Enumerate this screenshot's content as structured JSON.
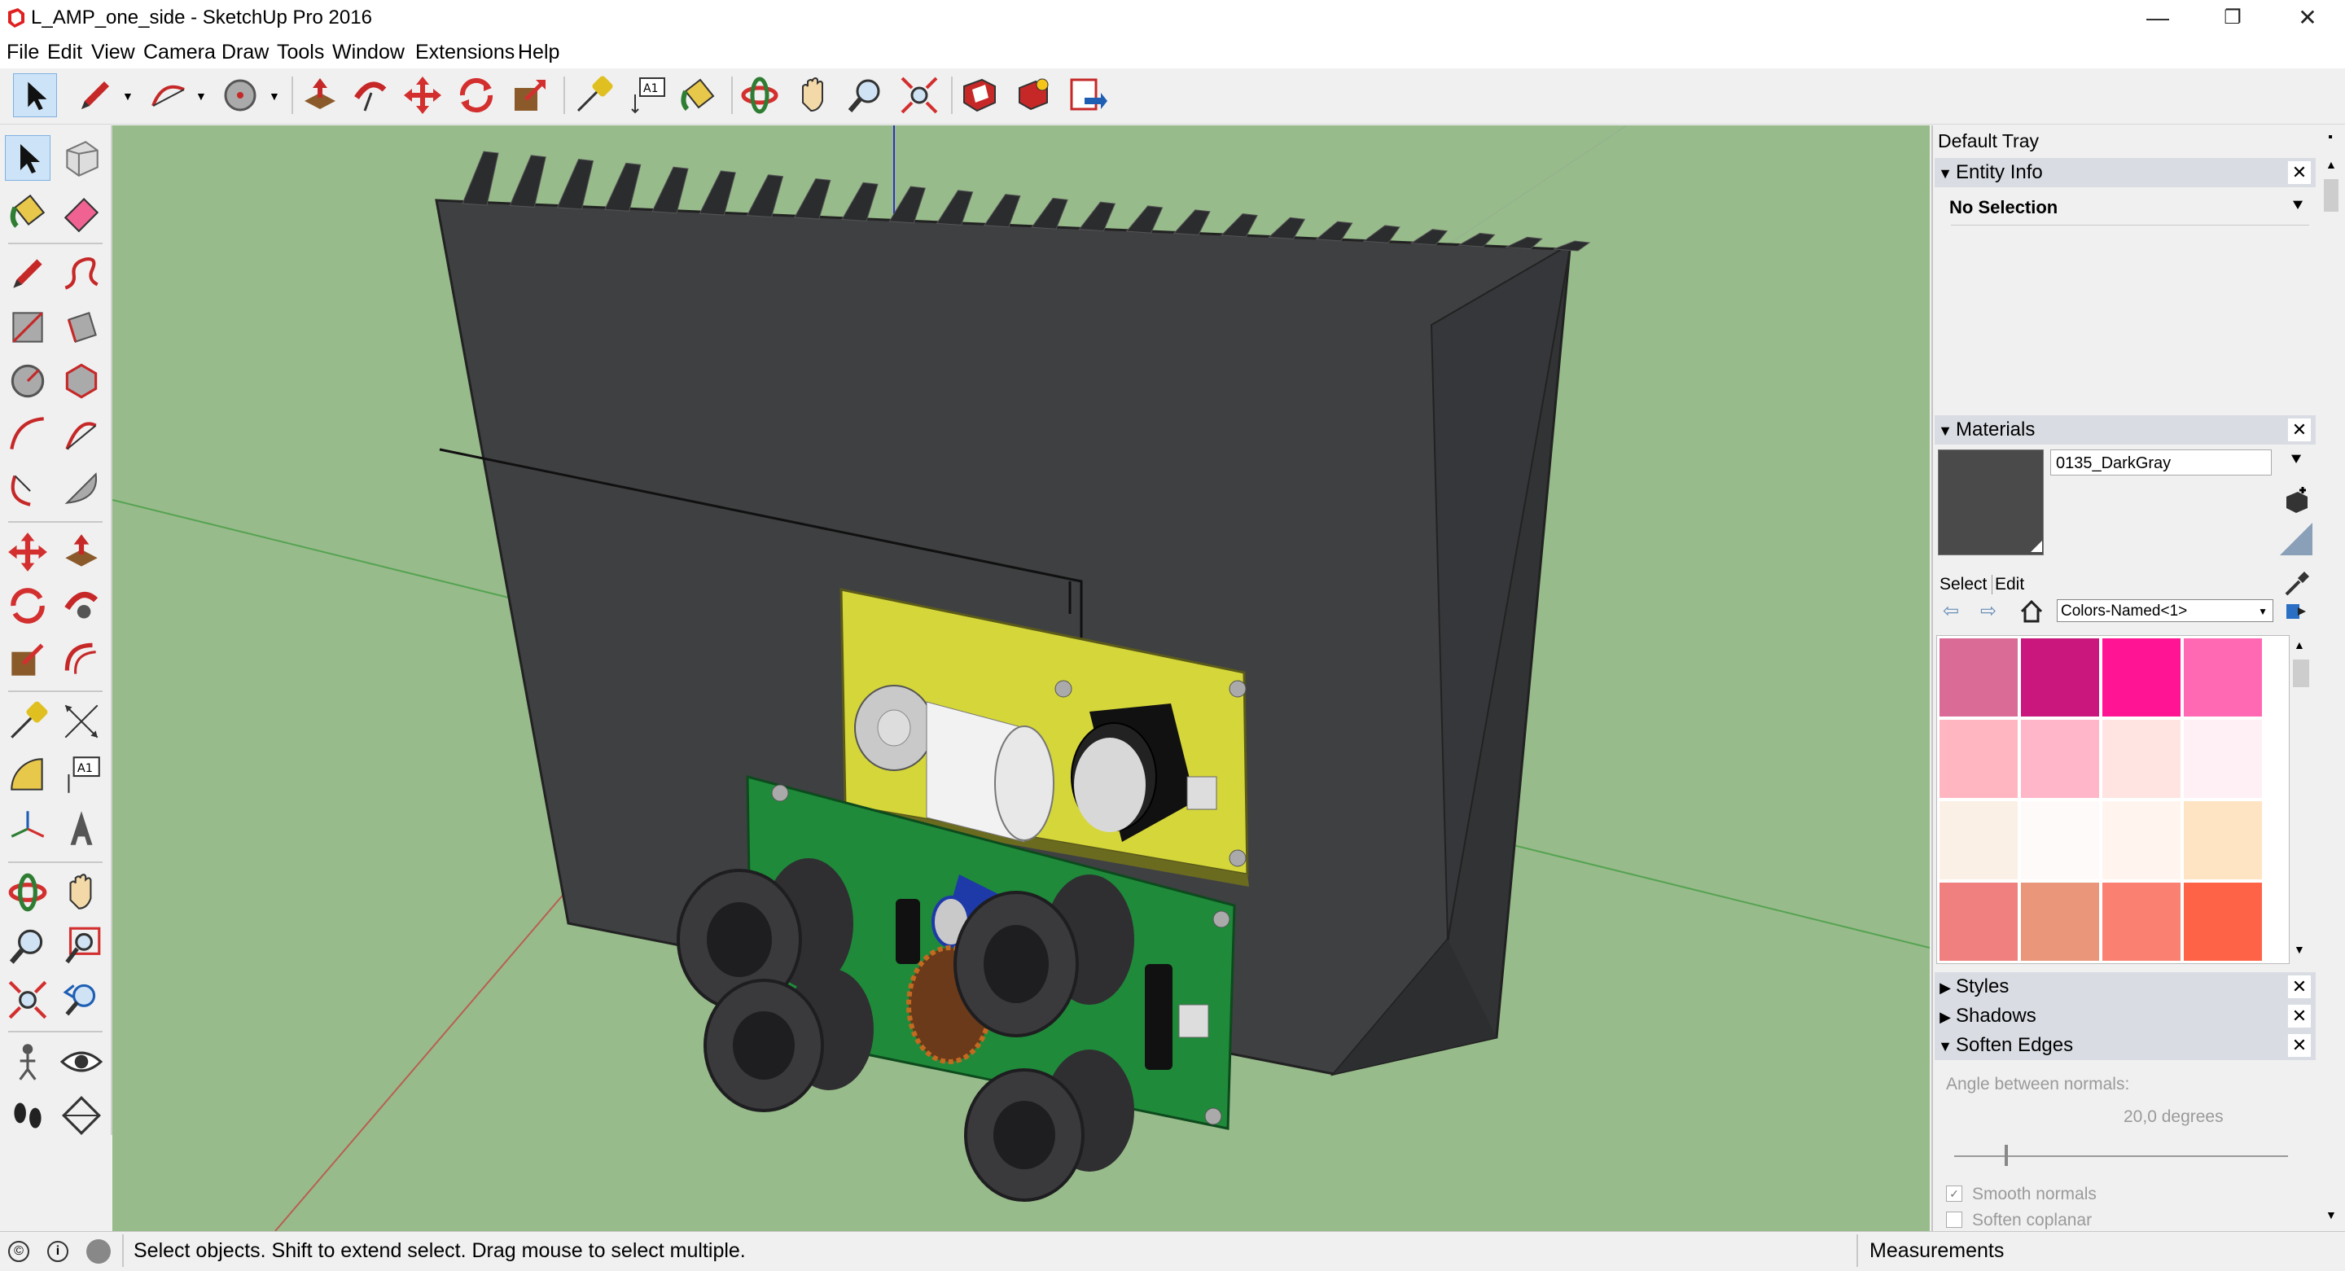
{
  "window": {
    "title": "L_AMP_one_side - SketchUp Pro 2016",
    "controls": {
      "minimize": "—",
      "restore": "❐",
      "close": "✕"
    }
  },
  "menu": [
    "File",
    "Edit",
    "View",
    "Camera",
    "Draw",
    "Tools",
    "Window",
    "Extensions",
    "Help"
  ],
  "toolbar_icons": [
    "select-icon",
    "pencil-icon",
    "arc-icon",
    "circle-icon",
    "push-pull-icon",
    "follow-me-icon",
    "move-icon",
    "rotate-icon",
    "scale-icon",
    "tape-measure-icon",
    "text-icon",
    "paint-bucket-icon",
    "orbit-icon",
    "pan-icon",
    "zoom-icon",
    "zoom-extents-icon",
    "3d-warehouse-icon",
    "extension-warehouse-icon",
    "layout-send-icon"
  ],
  "tray": {
    "title": "Default Tray",
    "entity_info": {
      "label": "Entity Info",
      "selection": "No Selection"
    },
    "materials": {
      "label": "Materials",
      "name_value": "0135_DarkGray",
      "preview_color": "#4a4a4a",
      "tab_select": "Select",
      "tab_edit": "Edit",
      "library": "Colors-Named<1>",
      "swatches": [
        "#d96b96",
        "#c9177e",
        "#ff1493",
        "#ff69b4",
        "#ffb6c1",
        "#ffb6c8",
        "#ffe4e1",
        "#fff0f5",
        "#faf0e6",
        "#fffafa",
        "#fff5ee",
        "#ffe4c4",
        "#f08080",
        "#e9967a",
        "#fa8072",
        "#ff6347"
      ]
    },
    "styles": {
      "label": "Styles"
    },
    "shadows": {
      "label": "Shadows"
    },
    "soften_edges": {
      "label": "Soften Edges",
      "angle_label": "Angle between normals:",
      "angle_value": "20,0  degrees",
      "angle_fraction": 0.15,
      "smooth_normals": "Smooth normals",
      "soften_coplanar": "Soften coplanar"
    }
  },
  "status": {
    "message": "Select objects. Shift to extend select. Drag mouse to select multiple.",
    "measurements_label": "Measurements"
  },
  "colors": {
    "viewport_bg": "#98bb8b",
    "heatsink": "#3f4042",
    "pcb_yellow": "#d5d63a",
    "pcb_green": "#1f8a3a"
  }
}
